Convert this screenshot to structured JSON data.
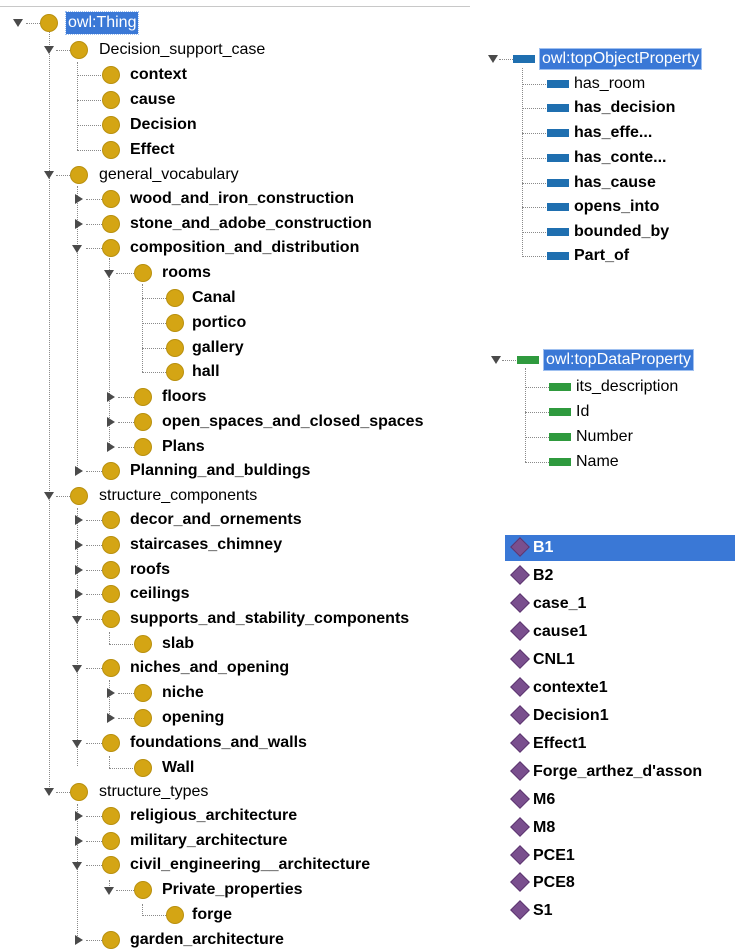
{
  "class_tree": {
    "root": "owl:Thing",
    "decision_support_case": "Decision_support_case",
    "context": "context",
    "cause": "cause",
    "decision": "Decision",
    "effect": "Effect",
    "general_vocabulary": "general_vocabulary",
    "wood_and_iron": "wood_and_iron_construction",
    "stone_and_adobe": "stone_and_adobe_construction",
    "composition": "composition_and_distribution",
    "rooms": "rooms",
    "canal": "Canal",
    "portico": "portico",
    "gallery": "gallery",
    "hall": "hall",
    "floors": "floors",
    "open_closed": "open_spaces_and_closed_spaces",
    "plans": "Plans",
    "planning": "Planning_and_buldings",
    "structure_components": "structure_components",
    "decor": "decor_and_ornements",
    "staircases": "staircases_chimney",
    "roofs": "roofs",
    "ceilings": "ceilings",
    "supports": "supports_and_stability_components",
    "slab": "slab",
    "niches": "niches_and_opening",
    "niche": "niche",
    "opening": "opening",
    "foundations": "foundations_and_walls",
    "wall": "Wall",
    "structure_types": "structure_types",
    "religious": "religious_architecture",
    "military": "military_architecture",
    "civil": "civil_engineering__architecture",
    "private": "Private_properties",
    "forge": "forge",
    "garden": "garden_architecture"
  },
  "object_properties": {
    "root": "owl:topObjectProperty",
    "items": [
      "has_room",
      "has_decision",
      "has_effe...",
      "has_conte...",
      "has_cause",
      "opens_into",
      "bounded_by",
      "Part_of"
    ]
  },
  "data_properties": {
    "root": "owl:topDataProperty",
    "items": [
      "its_description",
      "Id",
      "Number",
      "Name"
    ]
  },
  "individuals": {
    "items": [
      "B1",
      "B2",
      "case_1",
      "cause1",
      "CNL1",
      "contexte1",
      "Decision1",
      "Effect1",
      "Forge_arthez_d'asson",
      "M6",
      "M8",
      "PCE1",
      "PCE8",
      "S1"
    ]
  },
  "colors": {
    "class_dot": "#d4a514",
    "object_property": "#1f6fb0",
    "data_property": "#2f9a3e",
    "individual": "#7a4f8e",
    "selection": "#3a78d6"
  }
}
